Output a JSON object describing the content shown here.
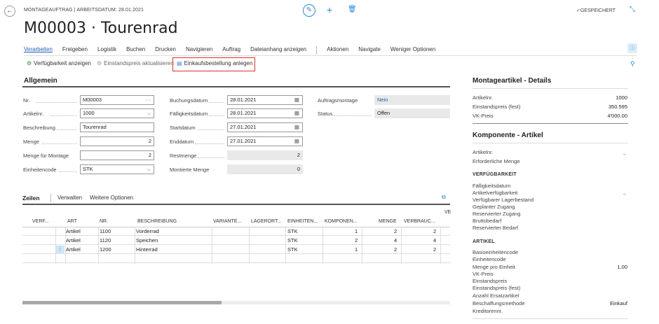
{
  "header": {
    "breadcrumb": "MONTAGEAUFTRAG | ARBEITSDATUM: 28.01.2021",
    "saved_status": "✓GESPEICHERT",
    "title": "M00003 · Tourenrad"
  },
  "menu": {
    "items": [
      "Verarbeiten",
      "Freigeben",
      "Logistik",
      "Buchen",
      "Drucken",
      "Navigieren",
      "Auftrag",
      "Dateianhang anzeigen",
      "Aktionen",
      "Navigate",
      "Weniger Optionen"
    ]
  },
  "actions": {
    "availability": "Verfügbarkeit anzeigen",
    "update_cost": "Einstandspreis aktualisieren",
    "create_purchase": "Einkaufsbestellung anlegen"
  },
  "general": {
    "section_title": "Allgemein",
    "labels": {
      "nr": "Nr.",
      "artikelnr": "Artikelnr.",
      "beschreibung": "Beschreibung",
      "menge": "Menge",
      "menge_montage": "Menge für Montage",
      "einheitencode": "Einheitencode",
      "buchungsdatum": "Buchungsdatum",
      "faelligkeitsdatum": "Fälligkeitsdatum",
      "startdatum": "Startdatum",
      "enddatum": "Enddatum",
      "restmenge": "Restmenge",
      "montierte_menge": "Montierte Menge",
      "auftragsmontage": "Auftragsmontage",
      "status": "Status"
    },
    "values": {
      "nr": "M00003",
      "artikelnr": "1000",
      "beschreibung": "Tourenrad",
      "menge": "2",
      "menge_montage": "2",
      "einheitencode": "STK",
      "buchungsdatum": "28.01.2021",
      "faelligkeitsdatum": "28.01.2021",
      "startdatum": "27.01.2021",
      "enddatum": "27.01.2021",
      "restmenge": "2",
      "montierte_menge": "0",
      "auftragsmontage": "Nein",
      "status": "Offen"
    }
  },
  "lines": {
    "tab": "Zeilen",
    "manage": "Verwalten",
    "more": "Weitere Optionen",
    "overflow_header": "VE",
    "columns": [
      "VERF...",
      "ART",
      "NR.",
      "BESCHREIBUNG",
      "VARIANTE...",
      "LAGERORT...",
      "EINHEITEN...",
      "KOMPONEN...",
      "MENGE",
      "VERBRAUC..."
    ],
    "rows": [
      {
        "art": "Artikel",
        "nr": "1100",
        "beschreibung": "Vorderrad",
        "einheit": "STK",
        "komponenten": "1",
        "menge": "2",
        "verbrauch": "2"
      },
      {
        "art": "Artikel",
        "nr": "1120",
        "beschreibung": "Speichen",
        "einheit": "STK",
        "komponenten": "2",
        "menge": "4",
        "verbrauch": "4"
      },
      {
        "art": "Artikel",
        "nr": "1200",
        "beschreibung": "Hinterrad",
        "einheit": "STK",
        "komponenten": "1",
        "menge": "2",
        "verbrauch": "2"
      }
    ]
  },
  "factbox": {
    "details_title": "Montageartikel - Details",
    "details": [
      {
        "label": "Artikelnr.",
        "value": "1000"
      },
      {
        "label": "Einstandspreis (fest)",
        "value": "350.595"
      },
      {
        "label": "VK-Preis",
        "value": "4'000.00"
      }
    ],
    "component_title": "Komponente - Artikel",
    "component_fields": [
      "Artikelnr.",
      "Erforderliche Menge"
    ],
    "component_dash": "–",
    "availability_title": "VERFÜGBARKEIT",
    "availability_fields": [
      "Fälligkeitsdatum",
      "Artikelverfügbarkeit",
      "Verfügbarer Lagerbestand",
      "Geplanter Zugang",
      "Reservierter Zugang",
      "Bruttobedarf",
      "Reservierter Bedarf"
    ],
    "availability_dash": "–",
    "article_title": "ARTIKEL",
    "article_fields": [
      "Basiseinheitencode",
      "Einheitencode",
      "Menge pro Einheit",
      "VK-Preis",
      "Einstandspreis",
      "Einstandspreis (fest)",
      "Anzahl Ersatzartikel",
      "Beschaffungsmethode",
      "Kreditorennr."
    ],
    "menge_pro_einheit": "1.00",
    "beschaffungsmethode": "Einkauf"
  }
}
